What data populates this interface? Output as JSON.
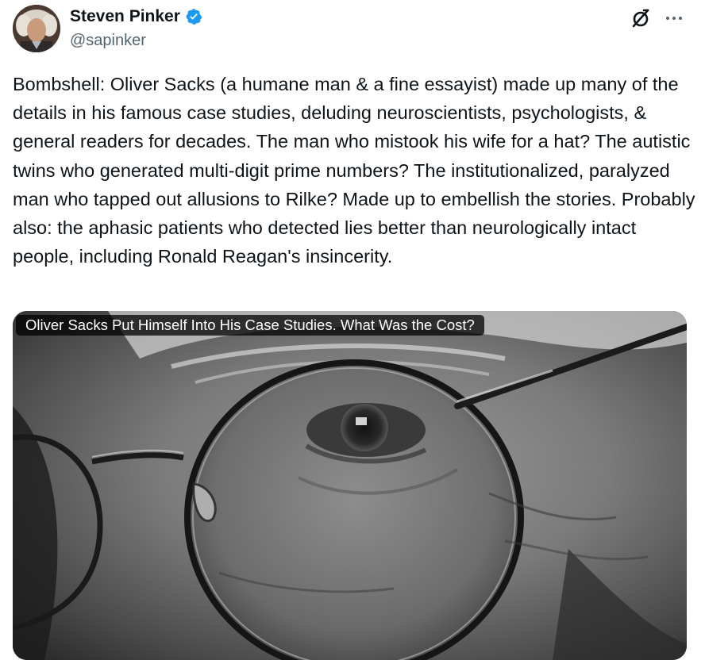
{
  "author": {
    "display_name": "Steven Pinker",
    "handle": "@sapinker",
    "verified": true,
    "verified_icon": "verified-badge-icon",
    "avatar_icon": "profile-avatar"
  },
  "header_actions": {
    "grok_icon": "grok-icon",
    "more_icon": "more-options-icon"
  },
  "tweet": {
    "text": "Bombshell: Oliver Sacks (a humane man & a fine essayist) made up many of the details in his famous case studies, deluding neuroscientists, psychologists, & general readers for decades. The man who mistook his wife for a hat? The autistic twins who generated multi-digit prime numbers? The institutionalized, paralyzed man who tapped out allusions to Rilke? Made up to embellish the stories. Probably also: the aphasic patients who detected lies better than neurologically intact people, including Ronald Reagan's insincerity."
  },
  "link_card": {
    "title": "Oliver Sacks Put Himself Into His Case Studies. What Was the Cost?"
  },
  "colors": {
    "text": "#0f1419",
    "secondary_text": "#536471",
    "verified_blue": "#1d9bf0"
  }
}
